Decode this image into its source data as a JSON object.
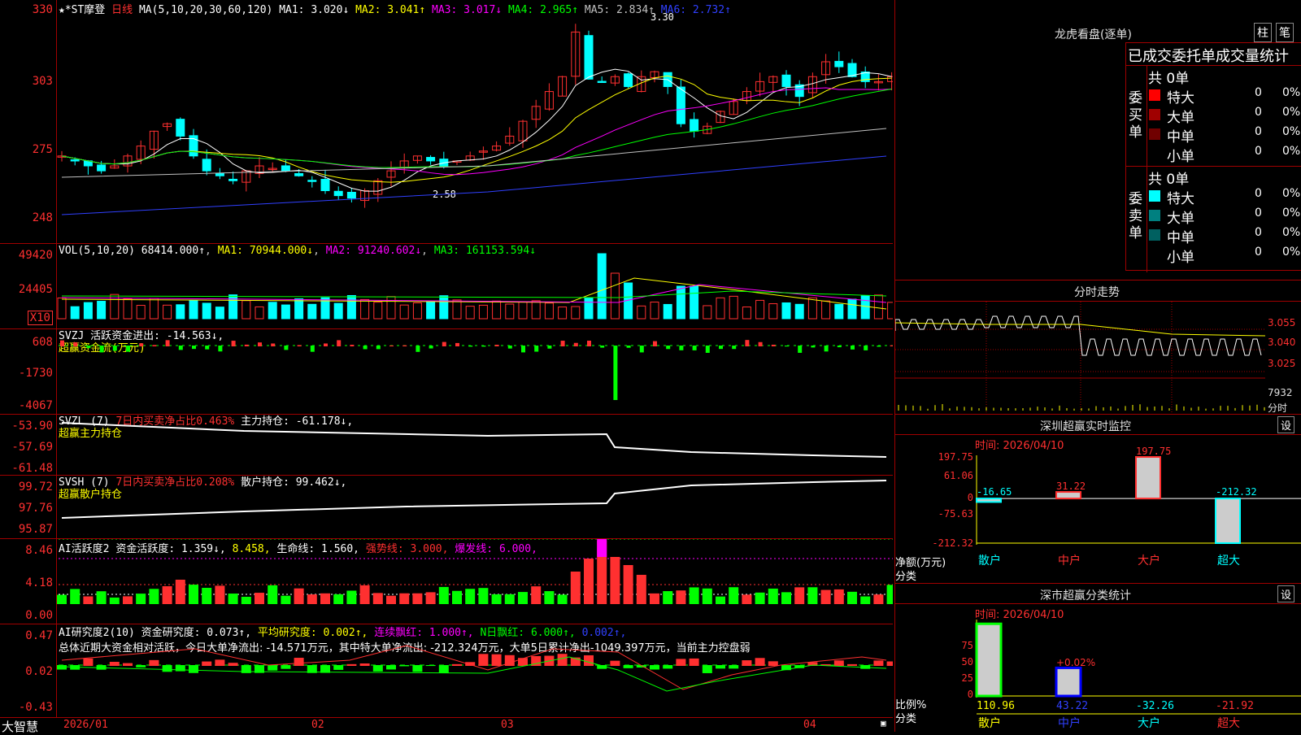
{
  "main": {
    "title": "★*ST摩登",
    "period": "日线",
    "ma_label": "MA(5,10,20,30,60,120)",
    "ma": [
      {
        "label": "MA1: 3.020↓",
        "color": "#ffffff"
      },
      {
        "label": "MA2: 3.041↑",
        "color": "#ffff00"
      },
      {
        "label": "MA3: 3.017↓",
        "color": "#ff00ff"
      },
      {
        "label": "MA4: 2.965↑",
        "color": "#00ff00"
      },
      {
        "label": "MA5: 2.834↑",
        "color": "#c0c0c0"
      },
      {
        "label": "MA6: 2.732↑",
        "color": "#3040ff"
      }
    ],
    "yticks": [
      "330",
      "303",
      "275",
      "248"
    ],
    "high_label": "3.30",
    "low_label": "2.58"
  },
  "vol": {
    "name": "VOL(5,10,20)",
    "value": "68414.000↑",
    "ma1": "MA1: 70944.000↓",
    "ma2": "MA2: 91240.602↓",
    "ma3": "MA3: 161153.594↓",
    "yticks": [
      "49420",
      "24405",
      "X10"
    ]
  },
  "svzj": {
    "name": "SVZJ",
    "line1": "活跃资金进出: -14.563↓,",
    "line2": "超赢资金流(万元)",
    "yticks": [
      "608",
      "-1730",
      "-4067"
    ]
  },
  "svzl": {
    "name": "SVZL (7)",
    "pct": "7日内买卖净占比0.463%",
    "val": "主力持仓: -61.178↓,",
    "line2": "超赢主力持仓",
    "yticks": [
      "-53.90",
      "-57.69",
      "-61.48"
    ]
  },
  "svsh": {
    "name": "SVSH (7)",
    "pct": "7日内买卖净占比0.208%",
    "val": "散户持仓: 99.462↓,",
    "line2": "超赢散户持仓",
    "yticks": [
      "99.72",
      "97.76",
      "95.87"
    ]
  },
  "ai1": {
    "name": "AI活跃度2",
    "a": "资金活跃度: 1.359↓,",
    "b": "8.458,",
    "c": "生命线: 1.560,",
    "d": "强势线: 3.000,",
    "e": "爆发线: 6.000,",
    "yticks": [
      "8.46",
      "4.18",
      "0.00"
    ]
  },
  "ai2": {
    "name": "AI研究度2(10)",
    "a": "资金研究度: 0.073↑,",
    "b": "平均研究度: 0.002↑,",
    "c": "连续飘红: 1.000↑,",
    "d": "N日飘红: 6.000↑,",
    "e": "0.002↑,",
    "summary": "总体近期大资金相对活跃，今日大单净流出: -14.571万元，其中特大单净流出: -212.324万元，大单5日累计净出-1049.397万元，当前主力控盘弱",
    "yticks": [
      "0.47",
      "0.02",
      "-0.43"
    ]
  },
  "xaxis": {
    "labels": [
      "2026/01",
      "02",
      "03",
      "04"
    ],
    "brand": "大智慧"
  },
  "lhb": {
    "title": "龙虎看盘(逐单)",
    "btn1": "柱",
    "btn2": "笔",
    "header": "已成交委托单成交量统计",
    "buy_label": "委买单",
    "sell_label": "委卖单",
    "buy_total": "共 0单",
    "sell_total": "共 0单",
    "buy_rows": [
      {
        "name": "特大",
        "n": "0",
        "p": "0%",
        "color": "#ff0000"
      },
      {
        "name": "大单",
        "n": "0",
        "p": "0%",
        "color": "#a00000"
      },
      {
        "name": "中单",
        "n": "0",
        "p": "0%",
        "color": "#700000"
      },
      {
        "name": "小单",
        "n": "0",
        "p": "0%",
        "color": ""
      }
    ],
    "sell_rows": [
      {
        "name": "特大",
        "n": "0",
        "p": "0%",
        "color": "#00ffff"
      },
      {
        "name": "大单",
        "n": "0",
        "p": "0%",
        "color": "#008080"
      },
      {
        "name": "中单",
        "n": "0",
        "p": "0%",
        "color": "#006060"
      },
      {
        "name": "小单",
        "n": "0",
        "p": "0%",
        "color": ""
      }
    ]
  },
  "intraday": {
    "title": "分时走势",
    "yticks": [
      "3.055",
      "3.040",
      "3.025"
    ],
    "vol_label": "7932",
    "unit": "分时"
  },
  "monitor": {
    "title": "深圳超赢实时监控",
    "set": "设",
    "time": "时间: 2026/04/10",
    "yticks": [
      "197.75",
      "61.06",
      "0",
      "-75.63",
      "-212.32"
    ],
    "ylabel1": "净额(万元)",
    "ylabel2": "分类",
    "cats": [
      "散户",
      "中户",
      "大户",
      "超大"
    ],
    "values": [
      -16.65,
      31.22,
      197.75,
      -212.32
    ],
    "value_labels": [
      "-16.65",
      "31.22",
      "197.75",
      "-212.32"
    ]
  },
  "stats": {
    "title": "深市超赢分类统计",
    "set": "设",
    "time": "时间: 2026/04/10",
    "yticks": [
      "75",
      "50",
      "25",
      "0"
    ],
    "ylabel1": "比例%",
    "ylabel2": "分类",
    "cats": [
      "散户",
      "中户",
      "大户",
      "超大"
    ],
    "values": [
      110.96,
      43.22,
      -32.26,
      -21.92
    ],
    "value_labels": [
      "110.96",
      "43.22",
      "-32.26",
      "-21.92"
    ],
    "annot": "+0.02%"
  },
  "chart_data": {
    "type": "bar",
    "title": "深圳超赢实时监控",
    "categories": [
      "散户",
      "中户",
      "大户",
      "超大"
    ],
    "series": [
      {
        "name": "净额(万元)",
        "values": [
          -16.65,
          31.22,
          197.75,
          -212.32
        ]
      }
    ],
    "ylim": [
      -212.32,
      197.75
    ]
  }
}
